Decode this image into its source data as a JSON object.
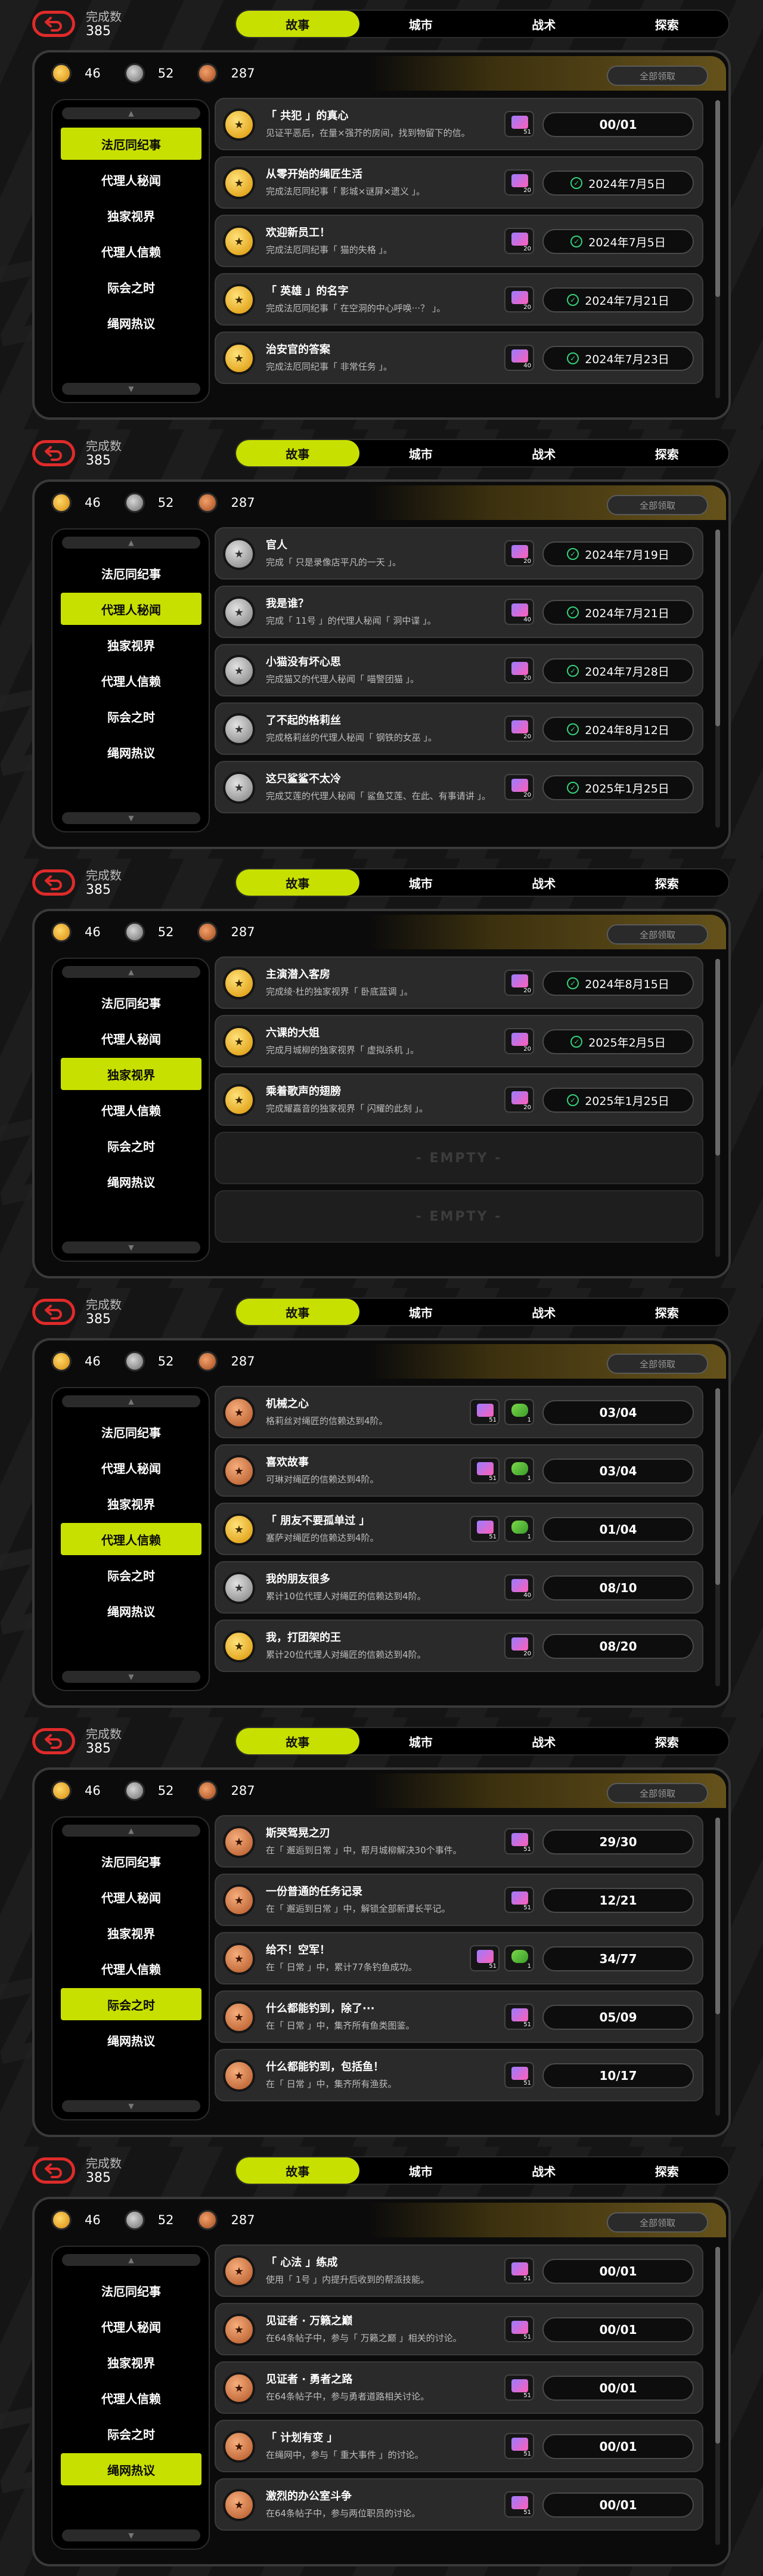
{
  "app": {
    "completed_label": "完成数",
    "completed_value": "385",
    "tabs": [
      "故事",
      "城市",
      "战术",
      "探索"
    ],
    "claim_all_label": "全部领取",
    "currencies": {
      "gold": "46",
      "silver": "52",
      "bronze": "287"
    },
    "sidebar_items": [
      "法厄同纪事",
      "代理人秘闻",
      "独家视界",
      "代理人信赖",
      "际会之时",
      "绳网热议"
    ],
    "colors": {
      "accent": "#c8e000",
      "back_button": "#e02a2a",
      "done_check": "#33d07a"
    },
    "empty_label": "- EMPTY -"
  },
  "screens": [
    {
      "active_tab": 0,
      "active_side": 0,
      "rows": [
        {
          "emblem": "gold",
          "title": "「 共犯 」的真心",
          "desc": "见证平恶后，在量×强芥的房间，找到物留下的信。",
          "rewards": [
            {
              "type": "ticket",
              "qty": "51"
            }
          ],
          "status": "00/01",
          "done": false
        },
        {
          "emblem": "gold",
          "title": "从零开始的绳匠生活",
          "desc": "完成法厄同纪事「 影城×谜屏×遗义 」。",
          "rewards": [
            {
              "type": "ticket",
              "qty": "20"
            }
          ],
          "status": "2024年7月5日",
          "done": true
        },
        {
          "emblem": "gold",
          "title": "欢迎新员工！",
          "desc": "完成法厄同纪事「 猫的失格 」。",
          "rewards": [
            {
              "type": "ticket",
              "qty": "20"
            }
          ],
          "status": "2024年7月5日",
          "done": true
        },
        {
          "emblem": "gold",
          "title": "「 英雄 」的名字",
          "desc": "完成法厄同纪事「 在空洞的中心呼唤···？ 」。",
          "rewards": [
            {
              "type": "ticket",
              "qty": "20"
            }
          ],
          "status": "2024年7月21日",
          "done": true
        },
        {
          "emblem": "gold",
          "title": "治安官的答案",
          "desc": "完成法厄同纪事「 非常任务 」。",
          "rewards": [
            {
              "type": "ticket",
              "qty": "40"
            }
          ],
          "status": "2024年7月23日",
          "done": true
        }
      ]
    },
    {
      "active_tab": 0,
      "active_side": 1,
      "rows": [
        {
          "emblem": "silver",
          "title": "官人",
          "desc": "完成「 只是录像店平凡的一天 」。",
          "rewards": [
            {
              "type": "ticket",
              "qty": "20"
            }
          ],
          "status": "2024年7月19日",
          "done": true
        },
        {
          "emblem": "silver",
          "title": "我是谁？",
          "desc": "完成「 11号 」的代理人秘闻「 洞中谍 」。",
          "rewards": [
            {
              "type": "ticket",
              "qty": "40"
            }
          ],
          "status": "2024年7月21日",
          "done": true
        },
        {
          "emblem": "silver",
          "title": "小猫没有坏心思",
          "desc": "完成猫又的代理人秘闻「 喵警团猫 」。",
          "rewards": [
            {
              "type": "ticket",
              "qty": "20"
            }
          ],
          "status": "2024年7月28日",
          "done": true
        },
        {
          "emblem": "silver",
          "title": "了不起的格莉丝",
          "desc": "完成格莉丝的代理人秘闻「 钢铁的女巫 」。",
          "rewards": [
            {
              "type": "ticket",
              "qty": "20"
            }
          ],
          "status": "2024年8月12日",
          "done": true
        },
        {
          "emblem": "silver",
          "title": "这只鲨鲨不太冷",
          "desc": "完成艾莲的代理人秘闻「 鲨鱼艾莲、在此、有事请讲 」。",
          "rewards": [
            {
              "type": "ticket",
              "qty": "20"
            }
          ],
          "status": "2025年1月25日",
          "done": true
        }
      ]
    },
    {
      "active_tab": 0,
      "active_side": 2,
      "rows": [
        {
          "emblem": "gold",
          "title": "主演潜入客房",
          "desc": "完成绫·杜的独家视界「 卧底蓝调 」。",
          "rewards": [
            {
              "type": "ticket",
              "qty": "20"
            }
          ],
          "status": "2024年8月15日",
          "done": true
        },
        {
          "emblem": "gold",
          "title": "六课的大姐",
          "desc": "完成月城柳的独家视界「 虚拟杀机 」。",
          "rewards": [
            {
              "type": "ticket",
              "qty": "20"
            }
          ],
          "status": "2025年2月5日",
          "done": true
        },
        {
          "emblem": "gold",
          "title": "乘着歌声的翅膀",
          "desc": "完成耀嘉音的独家视界「 闪耀的此刻 」。",
          "rewards": [
            {
              "type": "ticket",
              "qty": "20"
            }
          ],
          "status": "2025年1月25日",
          "done": true
        },
        {
          "empty": true
        },
        {
          "empty": true
        }
      ]
    },
    {
      "active_tab": 0,
      "active_side": 3,
      "rows": [
        {
          "emblem": "bronze",
          "title": "机械之心",
          "desc": "格莉丝对绳匠的信赖达到4阶。",
          "rewards": [
            {
              "type": "ticket",
              "qty": "51"
            },
            {
              "type": "cash",
              "qty": "1"
            }
          ],
          "status": "03/04",
          "done": false
        },
        {
          "emblem": "bronze",
          "title": "喜欢故事",
          "desc": "可琳对绳匠的信赖达到4阶。",
          "rewards": [
            {
              "type": "ticket",
              "qty": "51"
            },
            {
              "type": "cash",
              "qty": "1"
            }
          ],
          "status": "03/04",
          "done": false
        },
        {
          "emblem": "gold",
          "title": "「 朋友不要孤单过 」",
          "desc": "塞萨对绳匠的信赖达到4阶。",
          "rewards": [
            {
              "type": "ticket",
              "qty": "51"
            },
            {
              "type": "cash",
              "qty": "1"
            }
          ],
          "status": "01/04",
          "done": false
        },
        {
          "emblem": "silver",
          "title": "我的朋友很多",
          "desc": "累计10位代理人对绳匠的信赖达到4阶。",
          "rewards": [
            {
              "type": "ticket",
              "qty": "40"
            }
          ],
          "status": "08/10",
          "done": false
        },
        {
          "emblem": "gold",
          "title": "我，打团架的王",
          "desc": "累计20位代理人对绳匠的信赖达到4阶。",
          "rewards": [
            {
              "type": "ticket",
              "qty": "20"
            }
          ],
          "status": "08/20",
          "done": false
        }
      ]
    },
    {
      "active_tab": 0,
      "active_side": 4,
      "rows": [
        {
          "emblem": "bronze",
          "title": "斯哭驾晃之刃",
          "desc": "在「 邂逅到日常 」中，帮月城柳解决30个事件。",
          "rewards": [
            {
              "type": "ticket",
              "qty": "51"
            }
          ],
          "status": "29/30",
          "done": false
        },
        {
          "emblem": "bronze",
          "title": "一份普通的任务记录",
          "desc": "在「 邂逅到日常 」中，解锁全部新谭长平记。",
          "rewards": [
            {
              "type": "ticket",
              "qty": "51"
            }
          ],
          "status": "12/21",
          "done": false
        },
        {
          "emblem": "bronze",
          "title": "给不！空军！",
          "desc": "在「 日常 」中，累计77条钓鱼成功。",
          "rewards": [
            {
              "type": "ticket",
              "qty": "51"
            },
            {
              "type": "cash",
              "qty": "1"
            }
          ],
          "status": "34/77",
          "done": false
        },
        {
          "emblem": "bronze",
          "title": "什么都能钓到，除了···",
          "desc": "在「 日常 」中，集齐所有鱼类图鉴。",
          "rewards": [
            {
              "type": "ticket",
              "qty": "51"
            }
          ],
          "status": "05/09",
          "done": false
        },
        {
          "emblem": "bronze",
          "title": "什么都能钓到，包括鱼！",
          "desc": "在「 日常 」中，集齐所有渔获。",
          "rewards": [
            {
              "type": "ticket",
              "qty": "51"
            }
          ],
          "status": "10/17",
          "done": false
        }
      ]
    },
    {
      "active_tab": 0,
      "active_side": 5,
      "rows": [
        {
          "emblem": "bronze",
          "title": "「 心法 」练成",
          "desc": "使用「 1号 」内提升后收到的帮派技能。",
          "rewards": [
            {
              "type": "ticket",
              "qty": "51"
            }
          ],
          "status": "00/01",
          "done": false
        },
        {
          "emblem": "bronze",
          "title": "见证者 · 万籁之巅",
          "desc": "在64条帖子中，参与「 万籁之巅 」相关的讨论。",
          "rewards": [
            {
              "type": "ticket",
              "qty": "51"
            }
          ],
          "status": "00/01",
          "done": false
        },
        {
          "emblem": "bronze",
          "title": "见证者 · 勇者之路",
          "desc": "在64条帖子中，参与勇者道路相关讨论。",
          "rewards": [
            {
              "type": "ticket",
              "qty": "51"
            }
          ],
          "status": "00/01",
          "done": false
        },
        {
          "emblem": "bronze",
          "title": "「 计划有变 」",
          "desc": "在绳网中，参与「 重大事件 」的讨论。",
          "rewards": [
            {
              "type": "ticket",
              "qty": "51"
            }
          ],
          "status": "00/01",
          "done": false
        },
        {
          "emblem": "bronze",
          "title": "激烈的办公室斗争",
          "desc": "在64条帖子中，参与两位职员的讨论。",
          "rewards": [
            {
              "type": "ticket",
              "qty": "51"
            }
          ],
          "status": "00/01",
          "done": false
        }
      ]
    }
  ]
}
